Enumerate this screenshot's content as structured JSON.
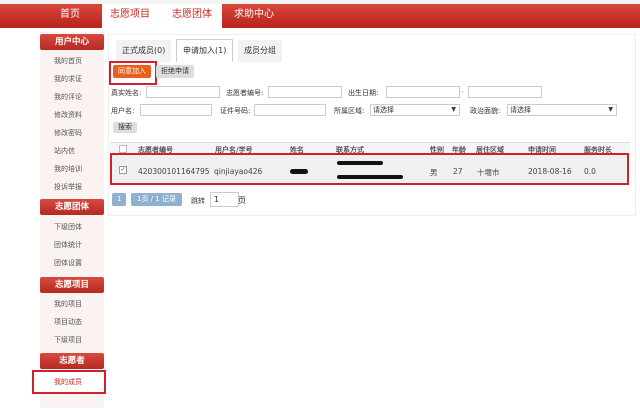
{
  "nav": {
    "items": [
      "首页",
      "志愿项目",
      "志愿团体",
      "求助中心"
    ]
  },
  "sidebar": {
    "groups": [
      {
        "title": "用户中心",
        "items": [
          "我的首页",
          "我的求证",
          "我的评论",
          "修改资料",
          "修改密码",
          "站内信",
          "我的培训",
          "投诉举报"
        ]
      },
      {
        "title": "志愿团体",
        "items": [
          "下级团体",
          "团体统计",
          "团体设置"
        ]
      },
      {
        "title": "志愿项目",
        "items": [
          "我的项目",
          "项目动态",
          "下级项目"
        ]
      },
      {
        "title": "志愿者",
        "items": [
          "我的成员"
        ]
      }
    ],
    "active": "我的成员"
  },
  "tabs": [
    "正式成员(0)",
    "申请加入(1)",
    "成员分组"
  ],
  "active_tab": "申请加入(1)",
  "actions": {
    "approve": "同意加入",
    "reject": "拒绝申请"
  },
  "filters": {
    "real_name": "真实姓名:",
    "volunteer_no": "志愿者编号:",
    "birth_date": "出生日期:",
    "date_sep": "-",
    "username": "用户名:",
    "id_no": "证件号码:",
    "region": "所属区域:",
    "region_value": "请选择",
    "political": "政治面貌:",
    "political_value": "请选择",
    "search": "搜索"
  },
  "table": {
    "headers": [
      "志愿者编号",
      "用户名/学号",
      "姓名",
      "联系方式",
      "性别",
      "年龄",
      "居住区域",
      "申请时间",
      "服务时长"
    ],
    "rows": [
      {
        "checked": true,
        "volunteer_no": "420300101164795",
        "username": "qinjiayao426",
        "gender": "男",
        "age": "27",
        "region": "十堰市",
        "apply_date": "2018-08-16",
        "hours": "0.0"
      }
    ]
  },
  "pagination": {
    "page": "1",
    "summary": "1页 / 1 记录",
    "goto": "跳转",
    "goto_value": "1",
    "unit": "页"
  },
  "colors": {
    "brand_red": "#c42a22",
    "approve_orange": "#e8601c",
    "highlight_border": "#d0202a"
  }
}
